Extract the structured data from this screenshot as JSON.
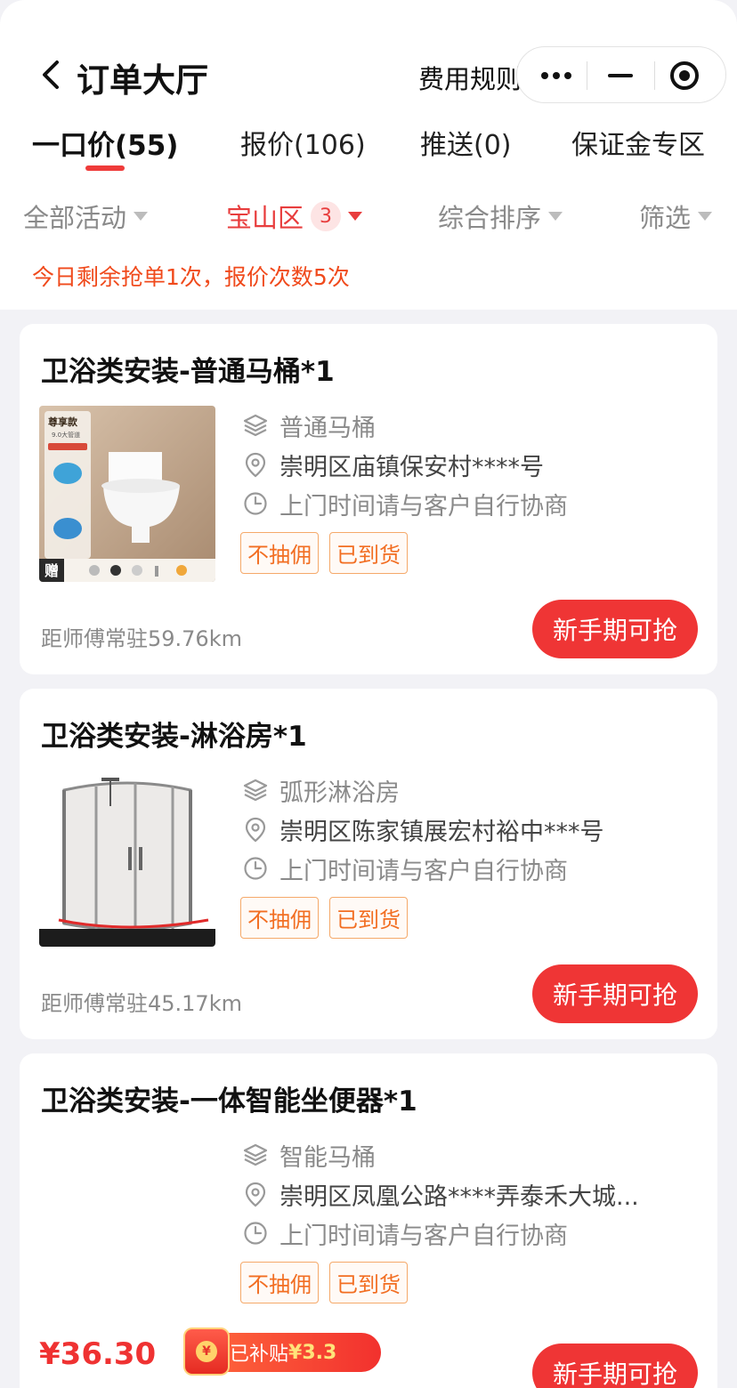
{
  "header": {
    "title": "订单大厅",
    "rules_link": "费用规则"
  },
  "tabs": [
    {
      "label": "一口价(55)",
      "active": true
    },
    {
      "label": "报价(106)"
    },
    {
      "label": "推送(0)"
    },
    {
      "label": "保证金专区"
    }
  ],
  "filters": [
    {
      "label": "全部活动"
    },
    {
      "label": "宝山区",
      "badge": "3",
      "active": true
    },
    {
      "label": "综合排序"
    },
    {
      "label": "筛选"
    }
  ],
  "notice": "今日剩余抢单1次，报价次数5次",
  "orders": [
    {
      "title": "卫浴类安装-普通马桶*1",
      "product": "普通马桶",
      "address": "崇明区庙镇保安村****号",
      "time": "上门时间请与客户自行协商",
      "tags": [
        "不抽佣",
        "已到货"
      ],
      "distance": "距师傅常驻59.76km",
      "action": "新手期可抢",
      "thumb_text": {
        "badge": "尊享款",
        "sub": "9.0大管道",
        "gift": "赠"
      }
    },
    {
      "title": "卫浴类安装-淋浴房*1",
      "product": "弧形淋浴房",
      "address": "崇明区陈家镇展宏村裕中***号",
      "time": "上门时间请与客户自行协商",
      "tags": [
        "不抽佣",
        "已到货"
      ],
      "distance": "距师傅常驻45.17km",
      "action": "新手期可抢"
    },
    {
      "title": "卫浴类安装-一体智能坐便器*1",
      "product": "智能马桶",
      "address": "崇明区凤凰公路****弄泰禾大城...",
      "time": "上门时间请与客户自行协商",
      "tags": [
        "不抽佣",
        "已到货"
      ],
      "price": "¥36.30",
      "subsidy_label": "已补贴",
      "subsidy_amount": "¥3.3",
      "action": "新手期可抢"
    }
  ],
  "colors": {
    "accent_red": "#ef3535",
    "notice_orange": "#f04a1c",
    "tag_orange": "#f26e22",
    "page_bg": "#f2f2f6"
  }
}
